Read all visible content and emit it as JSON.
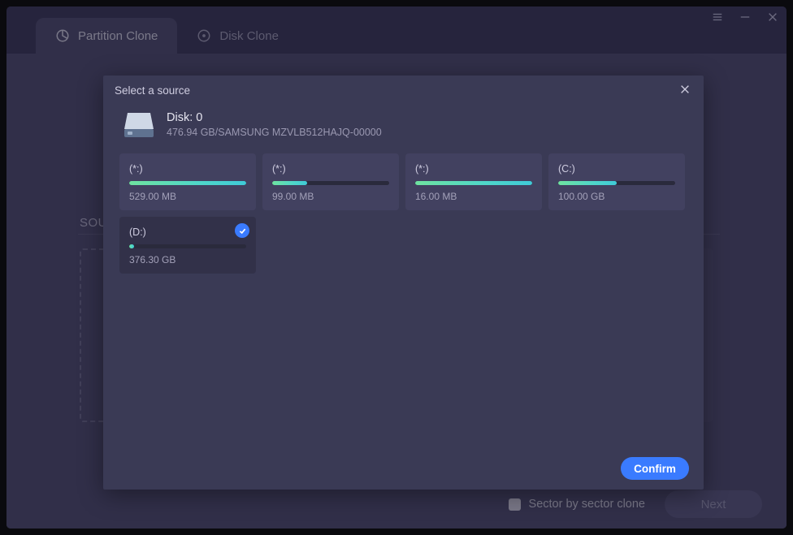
{
  "tabs": {
    "partition_clone": "Partition Clone",
    "disk_clone": "Disk Clone"
  },
  "main": {
    "source_label": "SOURCE"
  },
  "footer": {
    "sector_label": "Sector by sector clone",
    "next_label": "Next"
  },
  "modal": {
    "title": "Select a source",
    "disk_name": "Disk: 0",
    "disk_sub": "476.94 GB/SAMSUNG MZVLB512HAJQ-00000",
    "confirm_label": "Confirm",
    "partitions": [
      {
        "label": "(*:)",
        "size": "529.00 MB",
        "fill_pct": 100,
        "selected": false
      },
      {
        "label": "(*:)",
        "size": "99.00 MB",
        "fill_pct": 30,
        "selected": false
      },
      {
        "label": "(*:)",
        "size": "16.00 MB",
        "fill_pct": 100,
        "selected": false
      },
      {
        "label": "(C:)",
        "size": "100.00 GB",
        "fill_pct": 50,
        "selected": false
      },
      {
        "label": "(D:)",
        "size": "376.30 GB",
        "fill_pct": 4,
        "selected": true
      }
    ]
  }
}
